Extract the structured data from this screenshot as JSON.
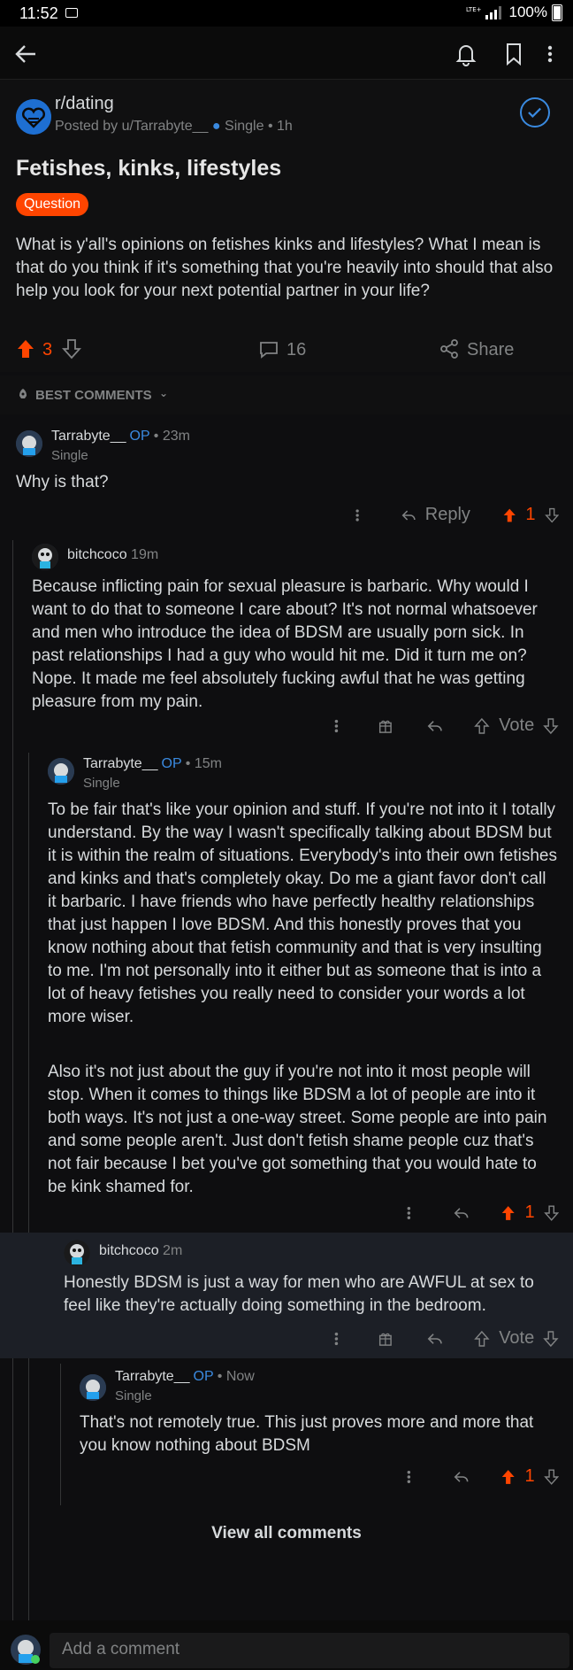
{
  "status": {
    "time": "11:52",
    "battery": "100%"
  },
  "post": {
    "subreddit": "r/dating",
    "posted_by": "Posted by u/Tarrabyte__",
    "user_flair": "Single",
    "time": "1h",
    "title": "Fetishes, kinks, lifestyles",
    "flair": "Question",
    "body": "What is y'all's opinions on fetishes kinks and lifestyles? What I mean is that do you think if it's something that you're heavily into should that also help you look for your next potential partner in your life?",
    "score": "3",
    "comments_count": "16",
    "share_label": "Share"
  },
  "sort_label": "BEST COMMENTS",
  "comments": [
    {
      "user": "Tarrabyte__",
      "op": "OP",
      "time": "23m",
      "flair": "Single",
      "text": "Why is that?",
      "reply_label": "Reply",
      "score": "1"
    },
    {
      "user": "bitchcoco",
      "time": "19m",
      "text": "Because inflicting pain for sexual pleasure is barbaric. Why would I want to do that to someone I care about? It's not normal whatsoever and men who introduce the idea of BDSM are usually porn sick. In past relationships I had a guy who would hit me. Did it turn me on? Nope. It made me feel absolutely fucking awful that he was getting pleasure from my pain.",
      "vote_label": "Vote"
    },
    {
      "user": "Tarrabyte__",
      "op": "OP",
      "time": "15m",
      "flair": "Single",
      "text_p1": "To be fair that's like your opinion and stuff. If you're not into it I totally understand. By the way I wasn't specifically talking about BDSM but it is within the realm of situations. Everybody's into their own fetishes and kinks and that's completely okay. Do me a giant favor don't call it barbaric. I have friends who have perfectly healthy relationships that just happen I love BDSM. And this honestly proves that you know nothing about that fetish community and that is very insulting to me. I'm not personally into it either but as someone that is into a lot of heavy fetishes you really need to consider your words a lot more wiser.",
      "text_p2": "Also it's not just about the guy if you're not into it most people will stop. When it comes to things like BDSM a lot of people are into it both ways. It's not just a one-way street. Some people are into pain and some people aren't. Just don't fetish shame people cuz that's not fair because I bet you've got something that you would hate to be kink shamed for.",
      "score": "1"
    },
    {
      "user": "bitchcoco",
      "time": "2m",
      "text": "Honestly BDSM is just a way for men who are AWFUL at sex to feel like they're actually doing something in the bedroom.",
      "vote_label": "Vote"
    },
    {
      "user": "Tarrabyte__",
      "op": "OP",
      "time": "Now",
      "flair": "Single",
      "text": "That's not remotely true. This just proves more and more that you know nothing about BDSM",
      "score": "1"
    }
  ],
  "view_all_label": "View all comments",
  "add_comment_placeholder": "Add a comment",
  "colors": {
    "accent": "#ff4500",
    "link": "#3a8ae0",
    "background": "#0e0e10"
  }
}
